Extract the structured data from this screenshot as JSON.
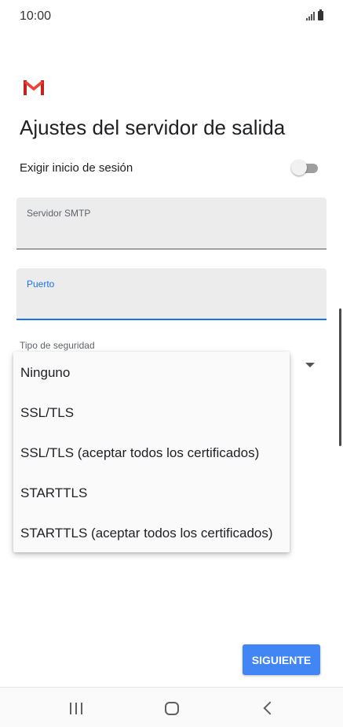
{
  "status_bar": {
    "time": "10:00",
    "icons": [
      "signal-icon",
      "battery-icon"
    ]
  },
  "app": {
    "logo": "gmail-logo",
    "brand_color": "#ea4335"
  },
  "page": {
    "title": "Ajustes del servidor de salida"
  },
  "login_toggle": {
    "label": "Exigir inicio de sesión",
    "enabled": false
  },
  "fields": {
    "smtp_server": {
      "label": "Servidor SMTP",
      "value": ""
    },
    "port": {
      "label": "Puerto",
      "value": "",
      "focused": true
    }
  },
  "security": {
    "label": "Tipo de seguridad",
    "options": [
      "Ninguno",
      "SSL/TLS",
      "SSL/TLS (aceptar todos los certificados)",
      "STARTTLS",
      "STARTTLS (aceptar todos los certificados)"
    ]
  },
  "actions": {
    "next_label": "SIGUIENTE"
  },
  "colors": {
    "accent": "#1a73e8",
    "button": "#4285f4",
    "field_background": "#ececec"
  },
  "nav_bar": {
    "icons": [
      "recent-apps-icon",
      "home-icon",
      "back-icon"
    ]
  }
}
